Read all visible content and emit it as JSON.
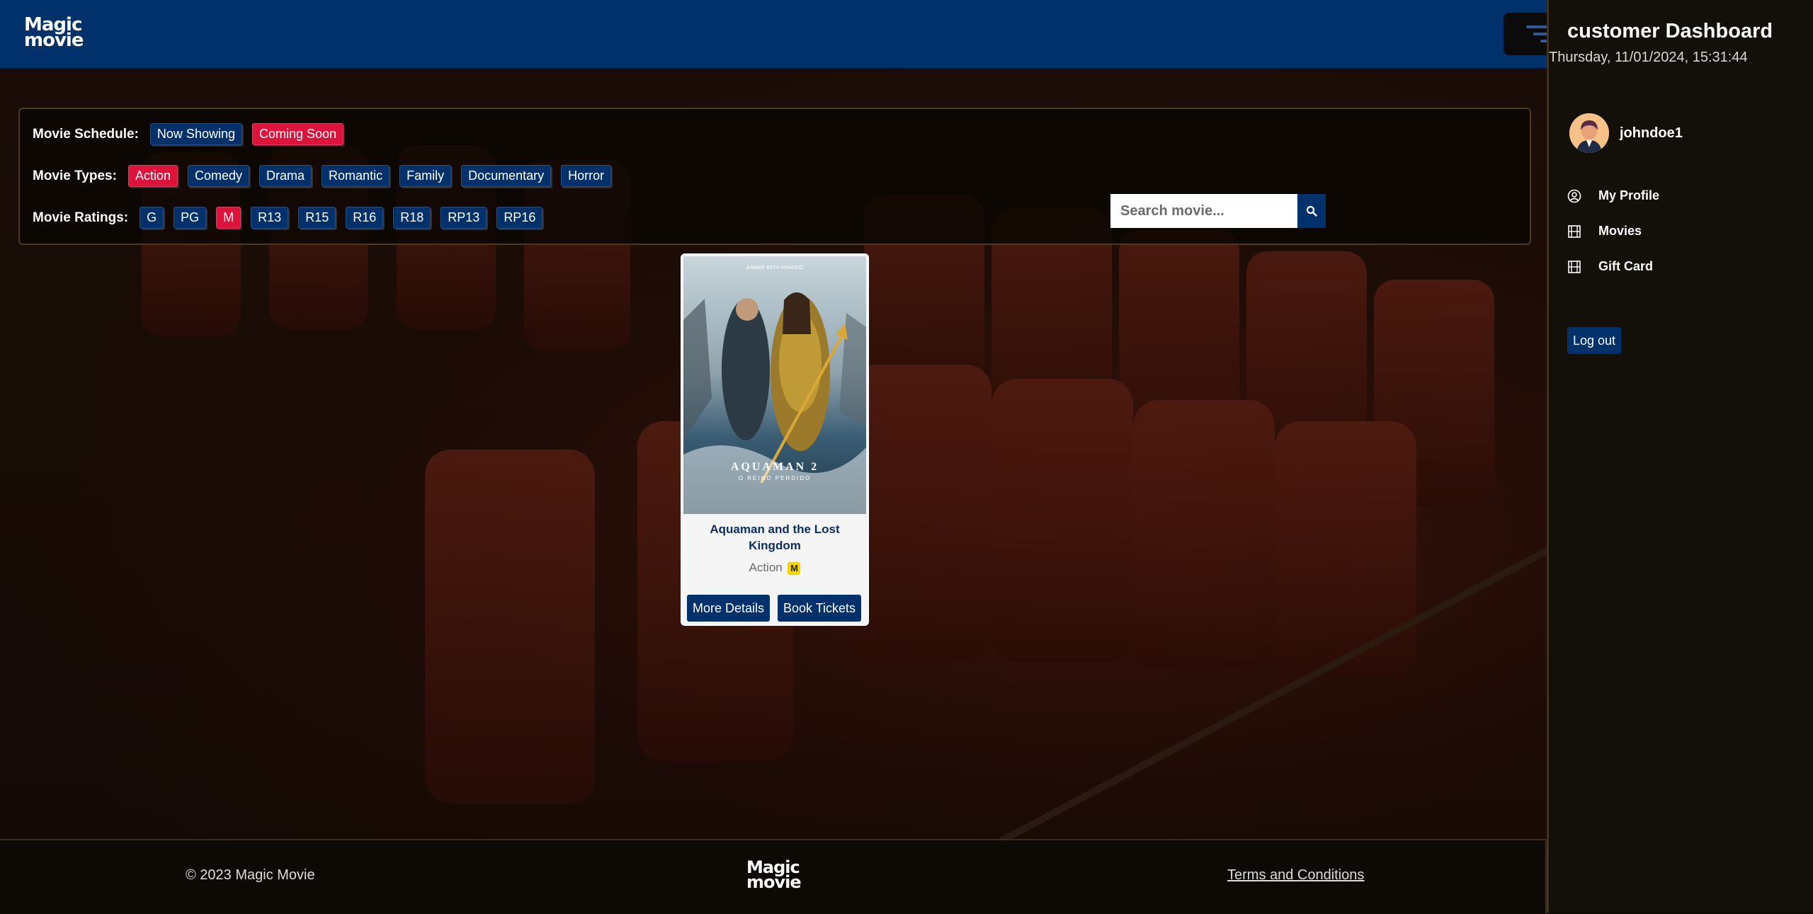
{
  "brand": {
    "logo_line1": "Magic",
    "logo_line2": "movie"
  },
  "filters": {
    "schedule": {
      "label": "Movie Schedule:",
      "options": [
        "Now Showing",
        "Coming Soon"
      ],
      "active": "Coming Soon"
    },
    "types": {
      "label": "Movie Types:",
      "options": [
        "Action",
        "Comedy",
        "Drama",
        "Romantic",
        "Family",
        "Documentary",
        "Horror"
      ],
      "active": "Action"
    },
    "ratings": {
      "label": "Movie Ratings:",
      "options": [
        "G",
        "PG",
        "M",
        "R13",
        "R15",
        "R16",
        "R18",
        "RP13",
        "RP16"
      ],
      "active": "M"
    }
  },
  "search": {
    "placeholder": "Search movie...",
    "icon": "search-icon"
  },
  "movie": {
    "title": "Aquaman and the Lost Kingdom",
    "genre": "Action",
    "rating": "M",
    "more_details_label": "More Details",
    "book_tickets_label": "Book Tickets",
    "poster": {
      "tagline": "A MARÉ ESTÁ VIRANDO",
      "title": "AQUAMAN 2",
      "subtitle": "O REINO PERDIDO"
    }
  },
  "footer": {
    "copyright": "© 2023 Magic Movie",
    "terms": "Terms and Conditions"
  },
  "sidebar": {
    "title": "customer Dashboard",
    "datetime": "Thursday, 11/01/2024, 15:31:44",
    "username": "johndoe1",
    "items": [
      {
        "label": "My Profile",
        "icon": "user-circle-icon"
      },
      {
        "label": "Movies",
        "icon": "film-icon"
      },
      {
        "label": "Gift Card",
        "icon": "film-icon"
      }
    ],
    "logout_label": "Log out"
  },
  "colors": {
    "header": "#00316b",
    "active_chip": "#dc143c",
    "rating_badge": "#f5d400"
  }
}
